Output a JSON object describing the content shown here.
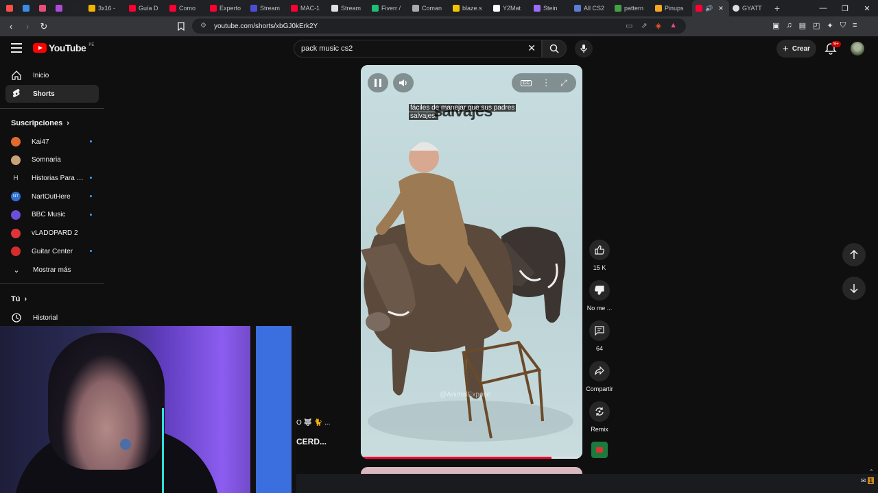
{
  "browser": {
    "tabs": [
      {
        "label": "",
        "color": "#ff4e45"
      },
      {
        "label": "",
        "color": "#3a8ee6"
      },
      {
        "label": "",
        "color": "#e94e77"
      },
      {
        "label": "",
        "color": "#b04ad9"
      },
      {
        "label": "",
        "color": "#222222"
      },
      {
        "label": "3x16 -",
        "color": "#f4b400"
      },
      {
        "label": "Guía D",
        "color": "#ff0033"
      },
      {
        "label": "Como",
        "color": "#ff0033"
      },
      {
        "label": "Experto",
        "color": "#ff0033"
      },
      {
        "label": "Stream",
        "color": "#4c4cd8"
      },
      {
        "label": "MAC-1",
        "color": "#ff0033"
      },
      {
        "label": "Stream",
        "color": "#e0e0e0"
      },
      {
        "label": "Fiverr /",
        "color": "#1dbf73"
      },
      {
        "label": "Coman",
        "color": "#aaaaaa"
      },
      {
        "label": "blaze.s",
        "color": "#f5c400"
      },
      {
        "label": "Y2Mat",
        "color": "#ffffff"
      },
      {
        "label": "Stein",
        "color": "#9b6cff"
      },
      {
        "label": "All CS2",
        "color": "#5b7bd5"
      },
      {
        "label": "pattern",
        "color": "#43a047"
      },
      {
        "label": "Pinups",
        "color": "#f5a623"
      }
    ],
    "active_tab": {
      "label": "",
      "color": "#ff0033"
    },
    "last_tab": {
      "label": "GYATT",
      "color": "#dddddd"
    },
    "url": "youtube.com/shorts/xbGJ0kErk2Y"
  },
  "header": {
    "logo_text": "YouTube",
    "logo_region": "PE",
    "search_query": "pack music cs2",
    "create_label": "Crear",
    "notif_badge": "9+"
  },
  "sidebar": {
    "primary": [
      {
        "label": "Inicio",
        "icon": "home-icon"
      },
      {
        "label": "Shorts",
        "icon": "shorts-icon",
        "active": true
      }
    ],
    "subs_heading": "Suscripciones",
    "subscriptions": [
      {
        "label": "Kai47",
        "color": "#e26a2c",
        "dot": true
      },
      {
        "label": "Somnaria",
        "color": "#c9a27a",
        "dot": false
      },
      {
        "label": "Historias Para D...",
        "color": "#0f0f0f",
        "letter": "H",
        "dot": true
      },
      {
        "label": "NartOutHere",
        "color": "#2f6fd0",
        "letter": "NT",
        "dot": true
      },
      {
        "label": "BBC Music",
        "color": "#6b4fd8",
        "dot": true
      },
      {
        "label": "vLADOPARD 2",
        "color": "#e0333a",
        "dot": false
      },
      {
        "label": "Guitar Center",
        "color": "#d62c2c",
        "dot": true
      }
    ],
    "show_more": "Mostrar más",
    "you_heading": "Tú",
    "history": "Historial"
  },
  "short": {
    "subtitle_line1": "fáciles de manejar que sus padres",
    "subtitle_line2": "salvajes.",
    "burned_caption": "salvajes",
    "watermark": "@AnimalExpose",
    "progress": 0.86
  },
  "actions": {
    "likes": "15 K",
    "dislike": "No me ...",
    "comments": "64",
    "share": "Compartir",
    "remix": "Remix"
  },
  "overlay": {
    "text1": "O 🐺 🐈 ...",
    "text2": "CERD..."
  },
  "tray": {
    "badge": "1"
  }
}
